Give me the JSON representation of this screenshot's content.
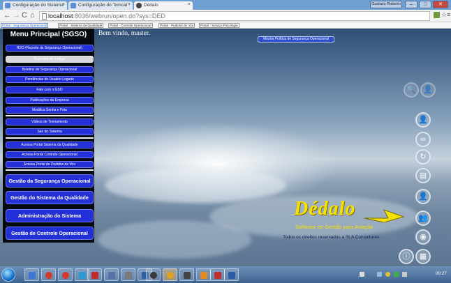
{
  "browser": {
    "tabs": [
      {
        "label": "Configuração do Sistema",
        "active": false
      },
      {
        "label": "Configuração do Tomcat",
        "active": false
      },
      {
        "label": "Dédalo",
        "active": true
      }
    ],
    "user_badge": "Gustavo Roberto",
    "url_host": "localhost",
    "url_path": ":8036/webrun/open.do?sys=DED",
    "bookmarks": [
      "Portal - Segurança Operacional",
      "Portal - Sistema da Qualidade",
      "Portal - Controle Operacional",
      "Portal - Pedidos de Voo",
      "Portal - Serviço Psicologia"
    ]
  },
  "page": {
    "welcome": "Bem vindo,  master.",
    "policy_button": "Mostra Política de Segurança Operacional"
  },
  "sidebar": {
    "title": "Menu Principal (SGSO)",
    "items": [
      {
        "label": "RSO (Reporte de Segurança Operacional)"
      },
      {
        "label": "Reportes de Fadiga"
      },
      {
        "label": "Boletins de Segurança Operacional"
      },
      {
        "label": "Pendências do Usuário Logado"
      },
      {
        "label": "Fale com o GSO"
      },
      {
        "label": "Publicações da Empresa"
      },
      {
        "label": "Modifica Senha e Foto"
      },
      {
        "label": "Vídeos de Treinamento"
      },
      {
        "label": "Sair do Sistema"
      },
      {
        "label": "Acessa Portal Sistema da Qualidade"
      },
      {
        "label": "Acessa Portal Controle Operacional"
      },
      {
        "label": "Acessa Portal de Pedidos de Voo"
      }
    ],
    "big_buttons": [
      {
        "label": "Gestão da Segurança Operacional"
      },
      {
        "label": "Gestão do Sistema da Qualidade"
      },
      {
        "label": "Administração do Sistema"
      },
      {
        "label": "Gestão de Controle Operacional"
      }
    ]
  },
  "logo": {
    "name": "Dédalo",
    "subtitle": "Software de Gestão para Aviação",
    "credits": "Todos os direitos reservados a SLA Consultores"
  },
  "colors": {
    "menu_blue": "#2330d8",
    "logo_yellow": "#f6e200",
    "sidebar_bg": "#04080f"
  },
  "taskbar": {
    "time": "09:27"
  }
}
